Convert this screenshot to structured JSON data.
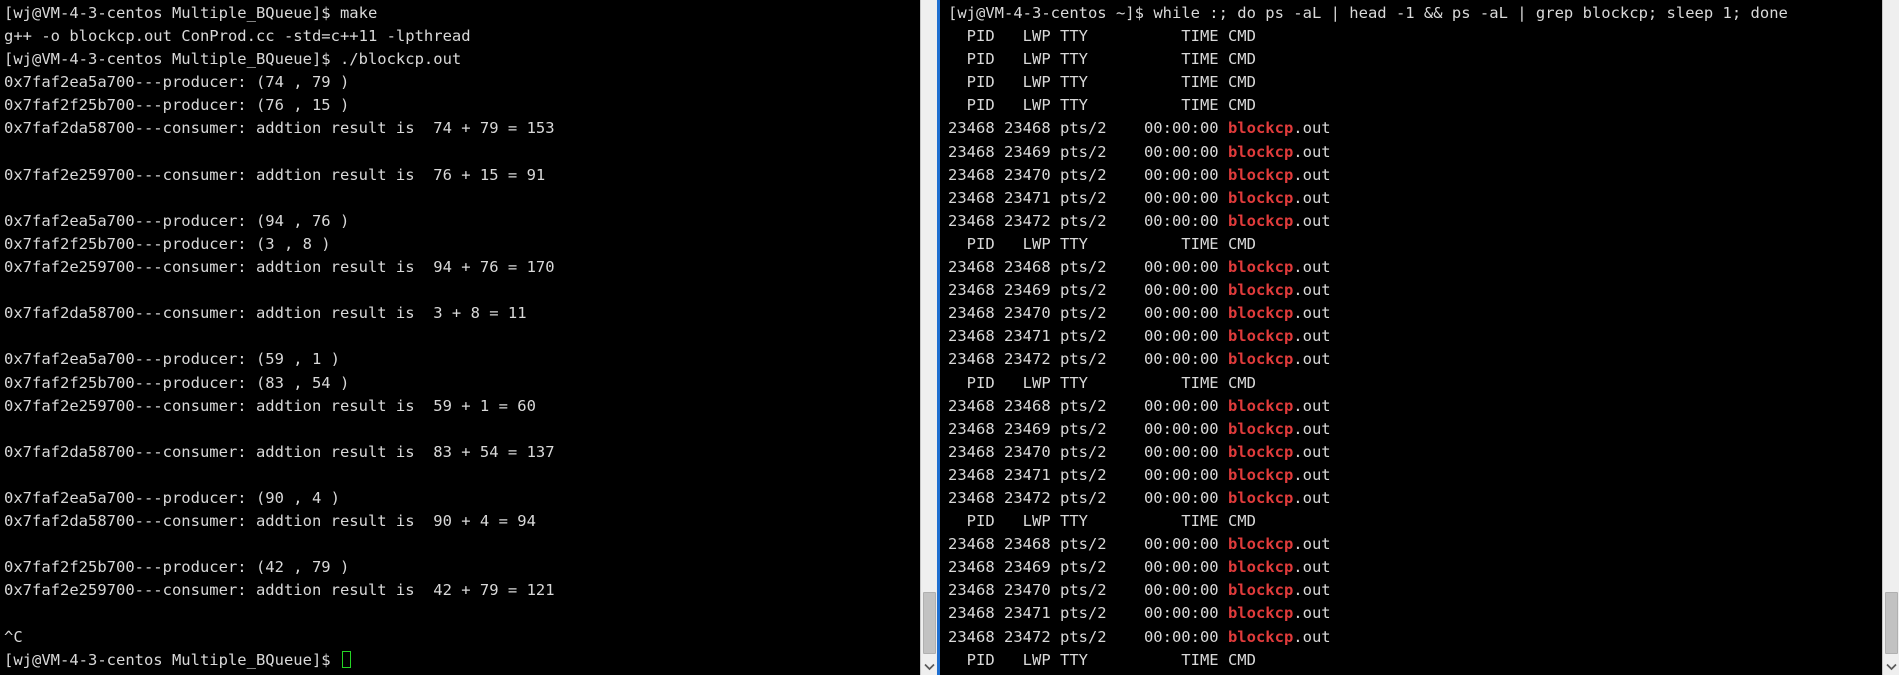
{
  "window": {
    "title": "Terminal - blockcp.out producer/consumer demo",
    "background": "#000000",
    "foreground": "#d9d9d9",
    "accent_focus_border": "#1f6fd0",
    "cursor_color": "#25d425",
    "grep_match_color": "#e03b3b"
  },
  "left_terminal": {
    "name": "left-terminal-pane",
    "prompt_user_host": "[wj@VM-4-3-centos Multiple_BQueue]$",
    "lines": [
      {
        "id": "l1",
        "text": "[wj@VM-4-3-centos Multiple_BQueue]$ make"
      },
      {
        "id": "l2",
        "text": "g++ -o blockcp.out ConProd.cc -std=c++11 -lpthread"
      },
      {
        "id": "l3",
        "text": "[wj@VM-4-3-centos Multiple_BQueue]$ ./blockcp.out"
      },
      {
        "id": "l4",
        "text": "0x7faf2ea5a700---producer: (74 , 79 )"
      },
      {
        "id": "l5",
        "text": "0x7faf2f25b700---producer: (76 , 15 )"
      },
      {
        "id": "l6",
        "text": "0x7faf2da58700---consumer: addtion result is  74 + 79 = 153"
      },
      {
        "id": "l7",
        "text": ""
      },
      {
        "id": "l8",
        "text": "0x7faf2e259700---consumer: addtion result is  76 + 15 = 91"
      },
      {
        "id": "l9",
        "text": ""
      },
      {
        "id": "l10",
        "text": "0x7faf2ea5a700---producer: (94 , 76 )"
      },
      {
        "id": "l11",
        "text": "0x7faf2f25b700---producer: (3 , 8 )"
      },
      {
        "id": "l12",
        "text": "0x7faf2e259700---consumer: addtion result is  94 + 76 = 170"
      },
      {
        "id": "l13",
        "text": ""
      },
      {
        "id": "l14",
        "text": "0x7faf2da58700---consumer: addtion result is  3 + 8 = 11"
      },
      {
        "id": "l15",
        "text": ""
      },
      {
        "id": "l16",
        "text": "0x7faf2ea5a700---producer: (59 , 1 )"
      },
      {
        "id": "l17",
        "text": "0x7faf2f25b700---producer: (83 , 54 )"
      },
      {
        "id": "l18",
        "text": "0x7faf2e259700---consumer: addtion result is  59 + 1 = 60"
      },
      {
        "id": "l19",
        "text": ""
      },
      {
        "id": "l20",
        "text": "0x7faf2da58700---consumer: addtion result is  83 + 54 = 137"
      },
      {
        "id": "l21",
        "text": ""
      },
      {
        "id": "l22",
        "text": "0x7faf2ea5a700---producer: (90 , 4 )"
      },
      {
        "id": "l23",
        "text": "0x7faf2da58700---consumer: addtion result is  90 + 4 = 94"
      },
      {
        "id": "l24",
        "text": ""
      },
      {
        "id": "l25",
        "text": "0x7faf2f25b700---producer: (42 , 79 )"
      },
      {
        "id": "l26",
        "text": "0x7faf2e259700---consumer: addtion result is  42 + 79 = 121"
      },
      {
        "id": "l27",
        "text": ""
      },
      {
        "id": "l28",
        "text": "^C"
      }
    ],
    "final_prompt": "[wj@VM-4-3-centos Multiple_BQueue]$ ",
    "scrollbar": {
      "name": "left-scrollbar",
      "arrow_icon": "chevron-down-icon"
    }
  },
  "right_terminal": {
    "name": "right-terminal-pane",
    "prompt": "[wj@VM-4-3-centos ~]$ ",
    "command": "while :; do ps -aL | head -1 && ps -aL | grep blockcp; sleep 1; done",
    "header": "  PID   LWP TTY          TIME CMD",
    "header_cols": [
      "PID",
      "LWP",
      "TTY",
      "TIME",
      "CMD"
    ],
    "proc_prefix_pad": "",
    "rows": [
      {
        "pid": "23468",
        "lwp": "23468",
        "tty": "pts/2",
        "time": "00:00:00",
        "cmd_match": "blockcp",
        "cmd_rest": ".out"
      },
      {
        "pid": "23468",
        "lwp": "23469",
        "tty": "pts/2",
        "time": "00:00:00",
        "cmd_match": "blockcp",
        "cmd_rest": ".out"
      },
      {
        "pid": "23468",
        "lwp": "23470",
        "tty": "pts/2",
        "time": "00:00:00",
        "cmd_match": "blockcp",
        "cmd_rest": ".out"
      },
      {
        "pid": "23468",
        "lwp": "23471",
        "tty": "pts/2",
        "time": "00:00:00",
        "cmd_match": "blockcp",
        "cmd_rest": ".out"
      },
      {
        "pid": "23468",
        "lwp": "23472",
        "tty": "pts/2",
        "time": "00:00:00",
        "cmd_match": "blockcp",
        "cmd_rest": ".out"
      }
    ],
    "body_sequence": [
      "header",
      "header",
      "header",
      "header",
      "rows",
      "header",
      "rows",
      "header",
      "rows",
      "header",
      "rows",
      "header"
    ],
    "scrollbar": {
      "name": "right-scrollbar",
      "arrow_icon": "chevron-down-icon"
    }
  }
}
